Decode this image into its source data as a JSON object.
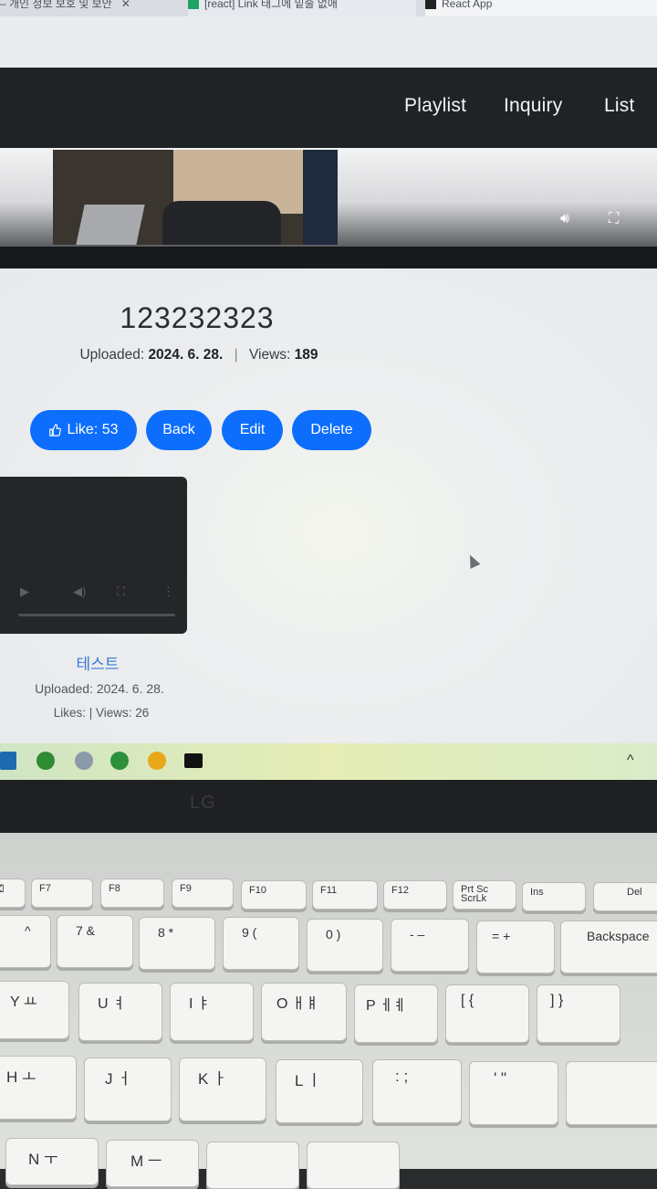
{
  "browser": {
    "tabs": [
      {
        "label": "– 개인 정보 보호 및 보안"
      },
      {
        "label": "[react] Link 태그에 밑줄 없애"
      },
      {
        "label": "React App"
      }
    ]
  },
  "navbar": {
    "links": [
      "Playlist",
      "Inquiry",
      "List"
    ]
  },
  "top_player": {
    "icons": [
      "volume-icon",
      "fullscreen-icon"
    ]
  },
  "video": {
    "title": "123232323",
    "uploaded_label": "Uploaded:",
    "uploaded_date": "2024. 6. 28.",
    "views_label": "Views:",
    "views_count": "189"
  },
  "actions": {
    "like_label": "Like: 53",
    "back_label": "Back",
    "edit_label": "Edit",
    "delete_label": "Delete"
  },
  "related": {
    "title": "테스트",
    "uploaded": "Uploaded: 2024. 6. 28.",
    "stats": "Likes: | Views: 26"
  },
  "taskbar": {
    "chevron": "^"
  },
  "laptop": {
    "logo": "LG"
  },
  "keyboard": {
    "fn_row": [
      "F7",
      "F8",
      "F9",
      "F10",
      "F11",
      "F12",
      "Prt Sc ScrLk",
      "Ins",
      "Del"
    ],
    "num_row": [
      "^",
      "7 &",
      "8 *",
      "9 (",
      "0 )",
      "- –",
      "= +",
      "Backspace"
    ],
    "top_row": [
      "Y ㅛ",
      "U ㅕ",
      "I ㅑ",
      "O ㅐㅒ",
      "P ㅔㅖ",
      "[ {",
      "] }"
    ],
    "home_row": [
      "H ㅗ",
      "J ㅓ",
      "K ㅏ",
      "L ㅣ",
      ": ;",
      "' \""
    ],
    "bottom_row": [
      "N ㅜ",
      "M ㅡ"
    ]
  },
  "colors": {
    "primary_button": "#0d6efd",
    "navbar": "#202326",
    "link": "#3b78d8"
  }
}
